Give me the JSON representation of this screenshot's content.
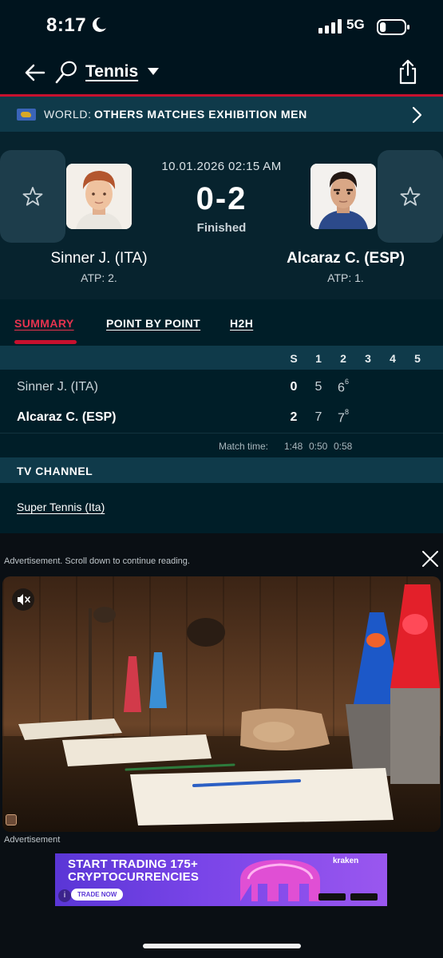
{
  "status_bar": {
    "time": "8:17",
    "network": "5G",
    "battery_level": 0.25
  },
  "header": {
    "sport": "Tennis"
  },
  "competition": {
    "country": "WORLD:",
    "name": "OTHERS MATCHES EXHIBITION MEN"
  },
  "match": {
    "datetime": "10.01.2026 02:15 AM",
    "score": "0-2",
    "status": "Finished",
    "home": {
      "name": "Sinner J. (ITA)",
      "rank": "ATP: 2."
    },
    "away": {
      "name": "Alcaraz C. (ESP)",
      "rank": "ATP: 1."
    }
  },
  "tabs": [
    {
      "label": "SUMMARY",
      "active": true
    },
    {
      "label": "POINT BY POINT",
      "active": false
    },
    {
      "label": "H2H",
      "active": false
    }
  ],
  "scoreboard": {
    "columns": [
      "S",
      "1",
      "2",
      "3",
      "4",
      "5"
    ],
    "rows": [
      {
        "name": "Sinner J. (ITA)",
        "sets": "0",
        "set1": "5",
        "set2": "6",
        "set2_tiebreak": "6"
      },
      {
        "name": "Alcaraz C. (ESP)",
        "sets": "2",
        "set1": "7",
        "set2": "7",
        "set2_tiebreak": "8"
      }
    ],
    "match_time_label": "Match time:",
    "match_times": [
      "1:48",
      "0:50",
      "0:58"
    ]
  },
  "tv": {
    "heading": "TV CHANNEL",
    "channel": "Super Tennis (Ita)"
  },
  "ads": {
    "notice": "Advertisement. Scroll down to continue reading.",
    "label": "Advertisement",
    "banner": {
      "headline_line1": "START TRADING 175+",
      "headline_line2": "CRYPTOCURRENCIES",
      "cta": "TRADE NOW",
      "brand": "kraken"
    }
  },
  "colors": {
    "accent": "#c8102e",
    "background": "#001e28",
    "section": "#0f3a4a"
  }
}
